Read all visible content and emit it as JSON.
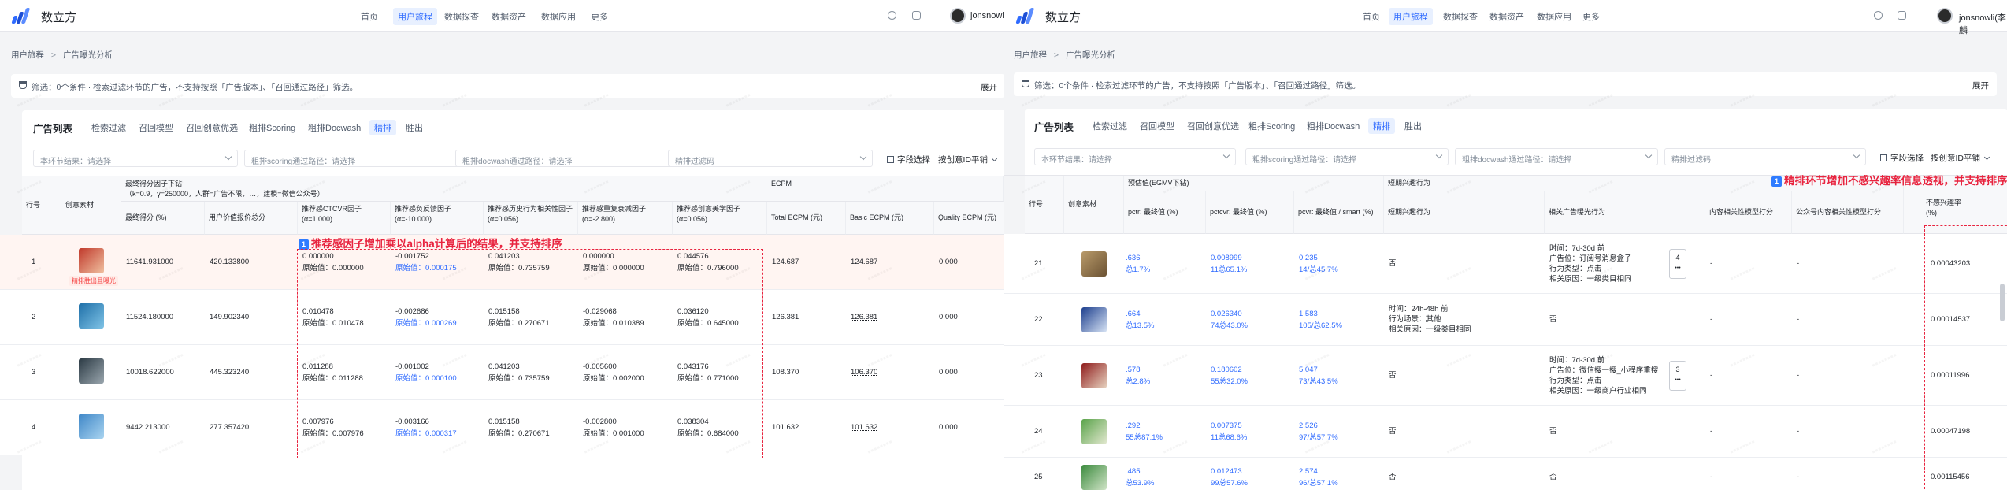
{
  "app": {
    "name": "数立方",
    "nav": [
      "首页",
      "用户旅程",
      "数据探查",
      "数据资产",
      "数据应用",
      "更多"
    ],
    "nav_active": "用户旅程",
    "user": "jonsnowli",
    "user_right": "jonsnowli(李麟"
  },
  "breadcrumb": {
    "root": "用户旅程",
    "sep": ">",
    "current": "广告曝光分析"
  },
  "filter": {
    "text": "筛选：0个条件 · 检索过滤环节的广告，不支持按照「广告版本」、「召回通过路径」筛选。",
    "expand": "展开"
  },
  "tabs": [
    "广告列表",
    "检索过滤",
    "召回模型",
    "召回创意优选",
    "粗排Scoring",
    "粗排Docwash",
    "精排",
    "胜出"
  ],
  "tab_active": "精排",
  "selects": {
    "stage": "本环节结果：请选择",
    "scoring": "粗排scoring通过路径：请选择",
    "docwash": "粗排docwash通过路径：请选择",
    "ranking": "精排过滤码"
  },
  "toolbar": {
    "field_select": "字段选择",
    "mode": "按创意ID平铺"
  },
  "left_table": {
    "headers": {
      "row_no": "行号",
      "creative": "创意素材",
      "group1": "最终得分因子下钻",
      "group1_sub": "（k=0.9，γ=250000，人群=广告不限，…，建模=微信公众号）",
      "ecpm": "ECPM",
      "final_score": "最终得分 (%)",
      "user_price": "用户价值报价总分",
      "f1": "推荐感CTCVR因子",
      "f1_sub": "(α=1.000)",
      "f2": "推荐感负反馈因子",
      "f2_sub": "(α=-10.000)",
      "f3": "推荐感历史行为相关性因子",
      "f3_sub": "(α=0.056)",
      "f4": "推荐感重复衰减因子",
      "f4_sub": "(α=-2.800)",
      "f5": "推荐感创意美学因子",
      "f5_sub": "(α=0.056)",
      "total_ecpm": "Total ECPM (元)",
      "basic_ecpm": "Basic ECPM (元)",
      "quality_ecpm": "Quality ECPM (元)"
    },
    "tag": "精排胜出且曝光",
    "rows": [
      {
        "no": "1",
        "final": "11641.931000",
        "price": "420.133800",
        "f1": "0.000000",
        "f1o": "原始值：0.000000",
        "f2": "-0.001752",
        "f2o": "原始值：0.000175",
        "f3": "0.041203",
        "f3o": "原始值：0.735759",
        "f4": "0.000000",
        "f4o": "原始值：0.000000",
        "f5": "0.044576",
        "f5o": "原始值：0.796000",
        "total": "124.687",
        "basic": "124.687",
        "quality": "0.000"
      },
      {
        "no": "2",
        "final": "11524.180000",
        "price": "149.902340",
        "f1": "0.010478",
        "f1o": "原始值：0.010478",
        "f2": "-0.002686",
        "f2o": "原始值：0.000269",
        "f3": "0.015158",
        "f3o": "原始值：0.270671",
        "f4": "-0.029068",
        "f4o": "原始值：0.010389",
        "f5": "0.036120",
        "f5o": "原始值：0.645000",
        "total": "126.381",
        "basic": "126.381",
        "quality": "0.000"
      },
      {
        "no": "3",
        "final": "10018.622000",
        "price": "445.323240",
        "f1": "0.011288",
        "f1o": "原始值：0.011288",
        "f2": "-0.001002",
        "f2o": "原始值：0.000100",
        "f3": "0.041203",
        "f3o": "原始值：0.735759",
        "f4": "-0.005600",
        "f4o": "原始值：0.002000",
        "f5": "0.043176",
        "f5o": "原始值：0.771000",
        "total": "108.370",
        "basic": "106.370",
        "quality": "0.000"
      },
      {
        "no": "4",
        "final": "9442.213000",
        "price": "277.357420",
        "f1": "0.007976",
        "f1o": "原始值：0.007976",
        "f2": "-0.003166",
        "f2o": "原始值：0.000317",
        "f3": "0.015158",
        "f3o": "原始值：0.270671",
        "f4": "-0.002800",
        "f4o": "原始值：0.001000",
        "f5": "0.038304",
        "f5o": "原始值：0.684000",
        "total": "101.632",
        "basic": "101.632",
        "quality": "0.000"
      }
    ]
  },
  "left_annotation": "推荐感因子增加乘以alpha计算后的结果，并支持排序",
  "right_table": {
    "headers": {
      "row_no": "行号",
      "creative": "创意素材",
      "group_pred": "预估值(EGMV下钻)",
      "group_short": "短期兴趣行为",
      "pctr": "pctr: 最终值 (%)",
      "pctcvr": "pctcvr: 最终值 (%)",
      "pcvr": "pcvr: 最终值 / smart (%)",
      "short_behavior": "短期兴趣行为",
      "related_ad": "相关广告曝光行为",
      "content_score": "内容相关性模型打分",
      "gzh_score": "公众号内容相关性模型打分",
      "uninterested": "不感兴趣率",
      "uninterested2": "(%)"
    },
    "rows": [
      {
        "no": "21",
        "pctr": ".636",
        "pctr2": "总1.7%",
        "pctcvr": "0.008999",
        "pctcvr2": "11总65.1%",
        "pcvr": "0.235",
        "pcvr2": "14/总45.7%",
        "short": "否",
        "related": [
          "时间：7d-30d 前",
          "广告位：订阅号消息盒子",
          "行为类型：点击",
          "相关原因：一级类目相同"
        ],
        "stepper": "4",
        "content": "-",
        "gzh": "-",
        "rate": "0.00043203"
      },
      {
        "no": "22",
        "pctr": ".664",
        "pctr2": "总13.5%",
        "pctcvr": "0.026340",
        "pctcvr2": "74总43.0%",
        "pcvr": "1.583",
        "pcvr2": "105/总62.5%",
        "short": [
          "时间：24h-48h 前",
          "行为场景：其他",
          "相关原因：一级类目相同"
        ],
        "related": "否",
        "content": "-",
        "gzh": "-",
        "rate": "0.00014537"
      },
      {
        "no": "23",
        "pctr": ".578",
        "pctr2": "总2.8%",
        "pctcvr": "0.180602",
        "pctcvr2": "55总32.0%",
        "pcvr": "5.047",
        "pcvr2": "73/总43.5%",
        "short": "否",
        "related": [
          "时间：7d-30d 前",
          "广告位：微信搜一搜_小程序重搜",
          "行为类型：点击",
          "相关原因：一级商户行业相同"
        ],
        "stepper": "3",
        "content": "-",
        "gzh": "-",
        "rate": "0.00011996"
      },
      {
        "no": "24",
        "pctr": ".292",
        "pctr2": "55总87.1%",
        "pctcvr": "0.007375",
        "pctcvr2": "11总68.6%",
        "pcvr": "2.526",
        "pcvr2": "97/总57.7%",
        "short": "否",
        "related": "否",
        "content": "-",
        "gzh": "-",
        "rate": "0.00047198"
      },
      {
        "no": "25",
        "pctr": ".485",
        "pctr2": "总53.9%",
        "pctcvr": "0.012473",
        "pctcvr2": "99总57.6%",
        "pcvr": "2.574",
        "pcvr2": "96/总57.1%",
        "short": "否",
        "related": "否",
        "content": "-",
        "gzh": "-",
        "rate": "0.00115456"
      }
    ]
  },
  "right_annotation": "精排环节增加不感兴趣率信息透视，并支持排序",
  "annotation_num": "1"
}
